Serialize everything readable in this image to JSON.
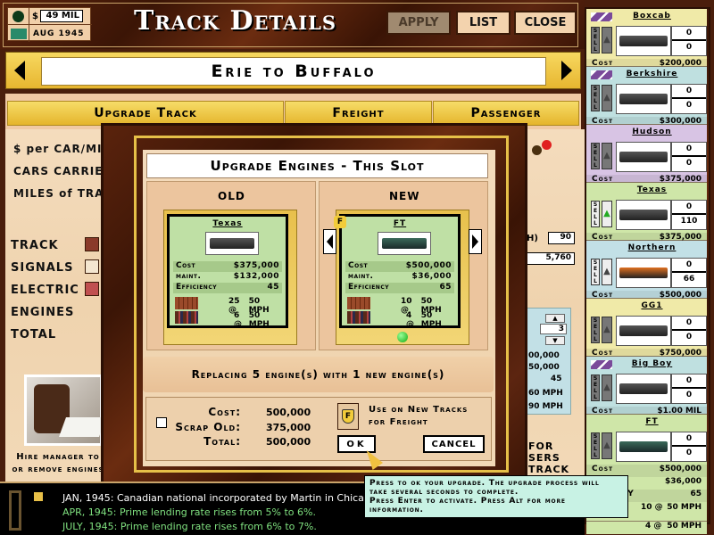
{
  "header": {
    "title": "Track Details",
    "money": "49 MIL",
    "money_symbol": "$",
    "date": "AUG 1945",
    "buttons": {
      "apply": "APPLY",
      "list": "LIST",
      "close": "CLOSE"
    }
  },
  "route": {
    "name": "Erie to Buffalo"
  },
  "tabs": [
    {
      "label": "Upgrade Track"
    },
    {
      "label": "Freight"
    },
    {
      "label": "Passenger"
    }
  ],
  "left_panel": {
    "stats_labels": [
      "$ per CAR/MILE",
      "CARS CARRIED",
      "MILES of TRACK"
    ],
    "upgrade_items": [
      "TRACK",
      "SIGNALS",
      "ELECTRIC",
      "ENGINES",
      "TOTAL"
    ],
    "manager_text_1": "Hire manager to",
    "manager_text_2": "or remove engines"
  },
  "midright": {
    "speed_value": "90",
    "speed_label_partial": "H)",
    "value2": "5,760",
    "slot_count": "3",
    "partial_values": [
      "00,000",
      "50,000",
      "45",
      "60 MPH",
      "90 MPH"
    ],
    "partial_text": [
      "FOR",
      "SERS",
      "TRACK"
    ]
  },
  "engine_list": [
    {
      "name": "Boxcab",
      "count_top": "0",
      "count_bottom": "0",
      "cost_label": "Cost",
      "cost": "$200,000",
      "color": "#f0eaa8"
    },
    {
      "name": "Berkshire",
      "count_top": "0",
      "count_bottom": "0",
      "cost_label": "Cost",
      "cost": "$300,000",
      "color": "#bfe0e0"
    },
    {
      "name": "Hudson",
      "count_top": "0",
      "count_bottom": "0",
      "cost_label": "Cost",
      "cost": "$375,000",
      "color": "#d8c4e4"
    },
    {
      "name": "Texas",
      "count_top": "0",
      "count_bottom": "110",
      "cost_label": "Cost",
      "cost": "$375,000",
      "color": "#cfe6a8"
    },
    {
      "name": "Northern",
      "count_top": "0",
      "count_bottom": "66",
      "cost_label": "Cost",
      "cost": "$500,000",
      "color": "#c2e0e6"
    },
    {
      "name": "GG1",
      "count_top": "0",
      "count_bottom": "0",
      "cost_label": "Cost",
      "cost": "$750,000",
      "color": "#f0eaa8"
    },
    {
      "name": "Big Boy",
      "count_top": "0",
      "count_bottom": "0",
      "cost_label": "Cost",
      "cost": "$1.00 MIL",
      "color": "#bfe0e0"
    },
    {
      "name": "FT",
      "count_top": "0",
      "count_bottom": "0",
      "cost_label": "Cost",
      "cost": "$500,000",
      "maint": "$36,000",
      "efficiency_label": "ency",
      "efficiency": "65",
      "freight_cap": "10 @",
      "freight_speed": "50 MPH",
      "pass_cap": "4 @",
      "pass_speed": "50 MPH",
      "color": "#cfe6a8"
    }
  ],
  "modal": {
    "title": "Upgrade Engines - This Slot",
    "old_header": "OLD",
    "new_header": "NEW",
    "old": {
      "name": "Texas",
      "cost_label": "Cost",
      "cost": "$375,000",
      "maint_label": "maint.",
      "maint": "$132,000",
      "efficiency_label": "Efficiency",
      "efficiency": "45",
      "freight_cap": "25 @",
      "freight_speed": "50 MPH",
      "pass_cap": "6 @",
      "pass_speed": "50 MPH"
    },
    "new": {
      "name": "FT",
      "badge": "F",
      "cost_label": "Cost",
      "cost": "$500,000",
      "maint_label": "maint.",
      "maint": "$36,000",
      "efficiency_label": "Efficiency",
      "efficiency": "65",
      "freight_cap": "10 @",
      "freight_speed": "50 MPH",
      "pass_cap": "4 @",
      "pass_speed": "50 MPH"
    },
    "replacing_text": "Replacing 5 engine(s) with 1 new engine(s)",
    "summary": {
      "cost_label": "Cost:",
      "cost": "500,000",
      "scrap_label": "Scrap Old:",
      "scrap": "375,000",
      "scrap_checked": false,
      "total_label": "Total:",
      "total": "500,000"
    },
    "freight_badge": "F",
    "freight_text_1": "Use on New Tracks",
    "freight_text_2": "for Freight",
    "ok_label": "OK",
    "cancel_label": "CANCEL"
  },
  "tooltip": {
    "line1": "Press to ok your upgrade. The upgrade process will",
    "line2": "take several seconds to complete.",
    "line3": "Press Enter to activate. Press Alt for more",
    "line4": "information."
  },
  "news": [
    {
      "text": "JAN, 1945: Canadian national incorporated by Martin in Chicago.",
      "color": "#ffffff"
    },
    {
      "text": "APR, 1945: Prime lending rate rises from 5% to 6%.",
      "color": "#7fe07f"
    },
    {
      "text": "JULY, 1945: Prime lending rate rises from 6% to 7%.",
      "color": "#7fe07f"
    }
  ]
}
